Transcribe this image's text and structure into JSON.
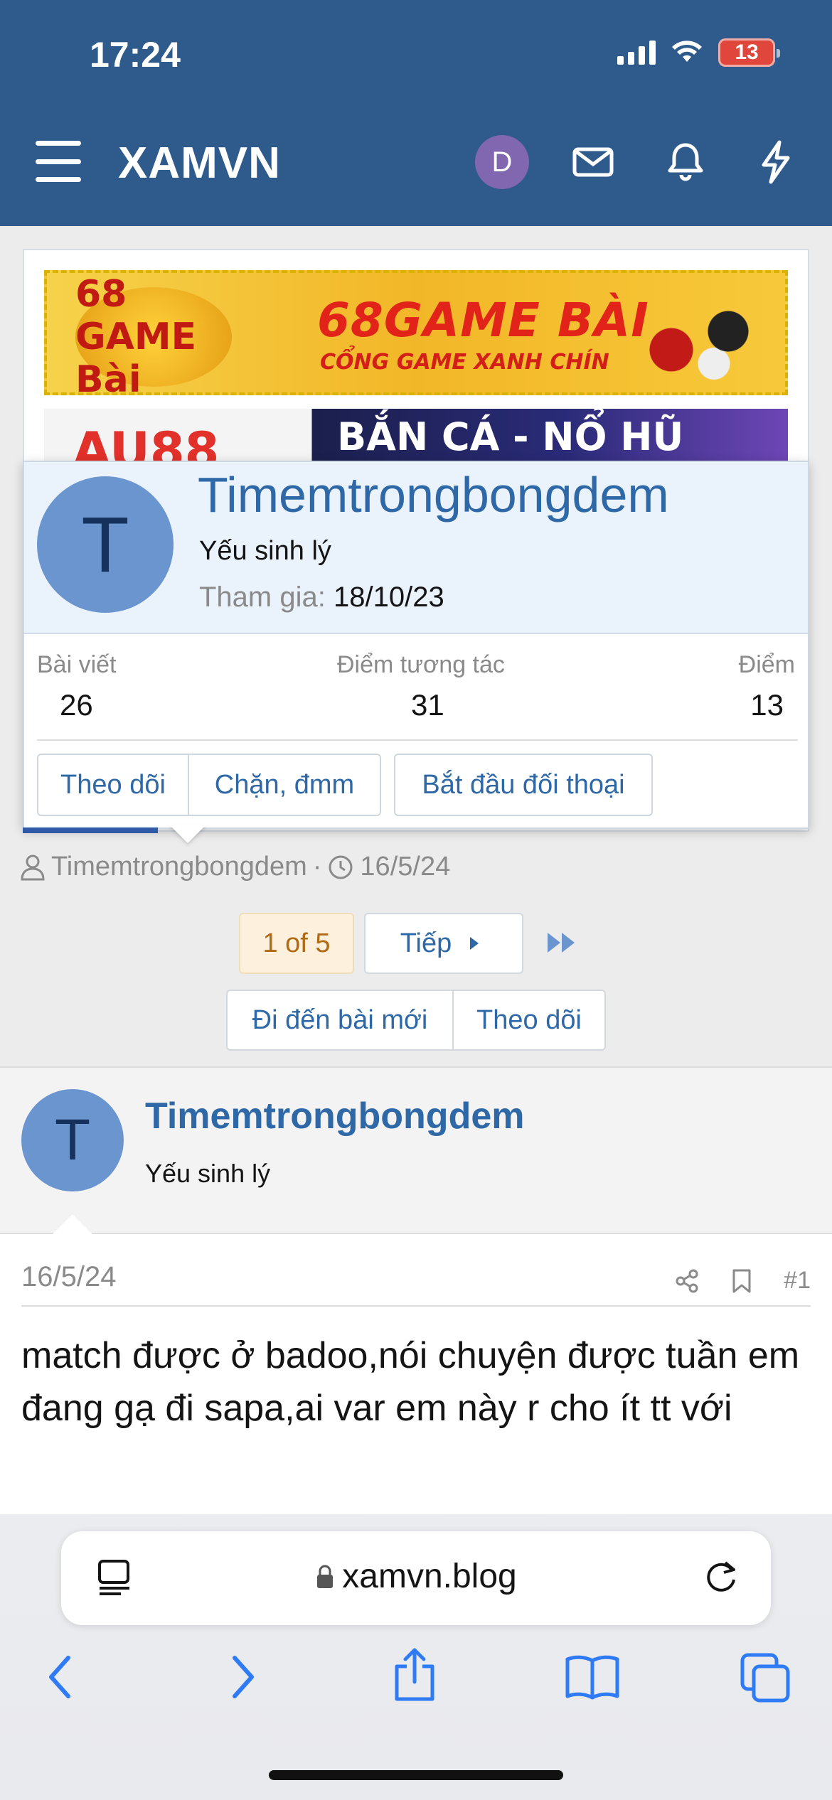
{
  "status": {
    "time": "17:24",
    "battery": "13"
  },
  "header": {
    "brand": "XAMVN",
    "avatar_letter": "D"
  },
  "ads": {
    "banner1": {
      "logo_text": "68 GAME Bài",
      "title": "68GAME BÀI",
      "subtitle": "CỔNG GAME XANH CHÍN"
    },
    "banner2": {
      "left_text": "AU88",
      "text": "BẮN CÁ - NỔ HŨ"
    }
  },
  "popup": {
    "avatar_letter": "T",
    "name": "Timemtrongbongdem",
    "user_title": "Yếu sinh lý",
    "joined_label": "Tham gia:",
    "joined_value": "18/10/23",
    "stats": [
      {
        "label": "Bài viết",
        "value": "26"
      },
      {
        "label": "Điểm tương tác",
        "value": "31"
      },
      {
        "label": "Điểm",
        "value": "13"
      }
    ],
    "buttons": {
      "follow": "Theo dõi",
      "block": "Chặn, đmm",
      "start_conversation": "Bắt đầu đối thoại"
    }
  },
  "thread_meta": {
    "author": "Timemtrongbongdem",
    "separator": "·",
    "date": "16/5/24"
  },
  "pagination": {
    "current": "1 of 5",
    "next": "Tiếp"
  },
  "thread_actions": {
    "new_posts": "Đi đến bài mới",
    "watch": "Theo dõi"
  },
  "post": {
    "avatar_letter": "T",
    "username": "Timemtrongbongdem",
    "user_title": "Yếu sinh lý",
    "date": "16/5/24",
    "number": "#1",
    "body": "match được ở badoo,nói chuyện được tuần em đang gạ đi sapa,ai var em này r cho ít tt với"
  },
  "browser": {
    "url": "xamvn.blog"
  },
  "colors": {
    "header": "#2f5a8c",
    "link": "#2f68a6",
    "avatar": "#6b95cf",
    "ios_blue": "#2f7bf6"
  }
}
